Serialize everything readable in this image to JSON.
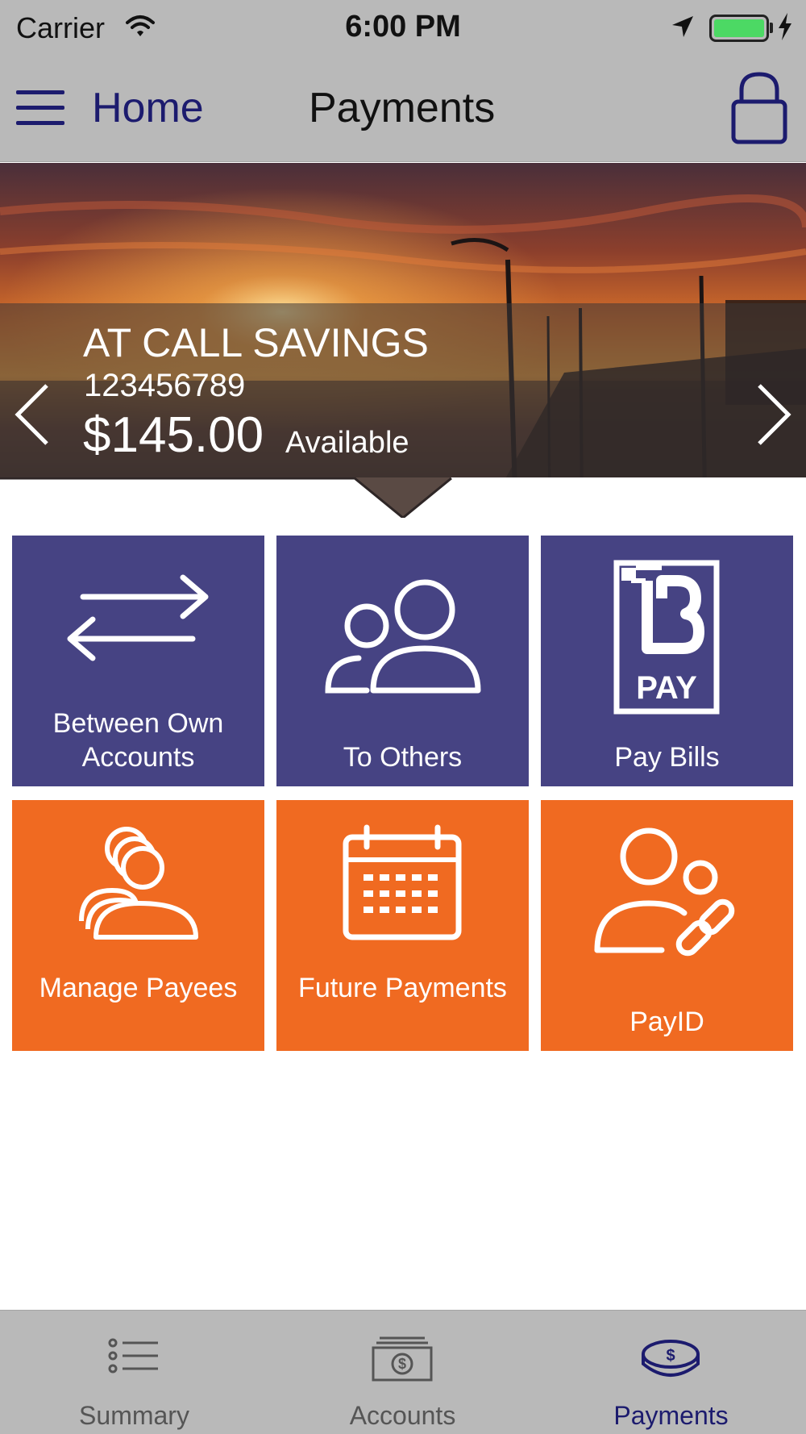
{
  "status_bar": {
    "carrier": "Carrier",
    "time": "6:00 PM",
    "battery_color": "#4cd964"
  },
  "nav": {
    "back_label": "Home",
    "title": "Payments"
  },
  "account": {
    "name": "AT CALL SAVINGS",
    "number": "123456789",
    "balance": "$145.00",
    "balance_label": "Available"
  },
  "tiles": [
    {
      "label": "Between Own Accounts",
      "icon": "transfer-arrows-icon",
      "color": "#464383"
    },
    {
      "label": "To Others",
      "icon": "people-icon",
      "color": "#464383"
    },
    {
      "label": "Pay Bills",
      "icon": "bpay-icon",
      "color": "#464383"
    },
    {
      "label": "Manage Payees",
      "icon": "payees-icon",
      "color": "#f06a21"
    },
    {
      "label": "Future Payments",
      "icon": "calendar-icon",
      "color": "#f06a21"
    },
    {
      "label": "PayID",
      "icon": "payid-link-icon",
      "color": "#f06a21"
    }
  ],
  "tab_bar": {
    "items": [
      {
        "label": "Summary",
        "icon": "list-icon"
      },
      {
        "label": "Accounts",
        "icon": "accounts-icon"
      },
      {
        "label": "Payments",
        "icon": "payments-coin-icon"
      }
    ],
    "active": "Payments",
    "active_color": "#1c1b6e"
  },
  "colors": {
    "bar_gray": "#b9b9b9",
    "brand_navy": "#1c1b6e",
    "tile_blue": "#464383",
    "tile_orange": "#f06a21"
  }
}
